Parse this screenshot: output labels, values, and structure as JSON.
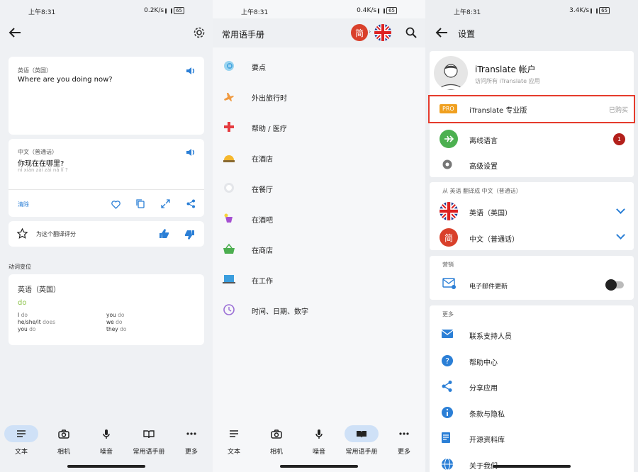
{
  "status": {
    "time": "上午8:31",
    "speeds": [
      "0.2K/s",
      "0.4K/s",
      "3.4K/s"
    ],
    "battery": "65"
  },
  "translate": {
    "source_lang": "英语（英国）",
    "source_text": "Where are you doing now?",
    "target_lang": "中文（普通话）",
    "target_text": "你现在在哪里?",
    "pinyin": "nǐ xiàn zài zài nǎ lǐ ?",
    "clear_label": "清除",
    "rate_label": "为这个翻译评分",
    "conjugation_title": "动词变位",
    "conj_lang": "英语（英国）",
    "verb": "do",
    "conj": [
      {
        "pronoun": "I",
        "form": "do"
      },
      {
        "pronoun": "you",
        "form": "do"
      },
      {
        "pronoun": "he/she/it",
        "form": "does"
      },
      {
        "pronoun": "we",
        "form": "do"
      },
      {
        "pronoun": "you",
        "form": "do"
      },
      {
        "pronoun": "they",
        "form": "do"
      }
    ]
  },
  "nav": {
    "text": "文本",
    "camera": "相机",
    "voice": "噪音",
    "phrasebook": "常用语手册",
    "more": "更多"
  },
  "phrasebook": {
    "title": "常用语手册",
    "flag_label": "简",
    "items": [
      "要点",
      "外出旅行时",
      "帮助 / 医疗",
      "在酒店",
      "在餐厅",
      "在酒吧",
      "在商店",
      "在工作",
      "时间、日期、数字"
    ]
  },
  "settings": {
    "title": "设置",
    "account_title": "iTranslate 帐户",
    "account_sub": "访问所有 iTranslate 应用",
    "pro_badge": "PRO",
    "pro_label": "iTranslate 专业版",
    "pro_status": "已购买",
    "offline_label": "离线语言",
    "offline_badge": "1",
    "advanced_label": "高级设置",
    "direction_label": "从 英语 翻译成 中文（普通话）",
    "lang_from": "英语（英国）",
    "lang_to": "中文（普通话）",
    "zh_flag": "简",
    "marketing_label": "营销",
    "email_label": "电子邮件更新",
    "more_label": "更多",
    "more_items": [
      "联系支持人员",
      "帮助中心",
      "分享应用",
      "条款与隐私",
      "开源资料库",
      "关于我们"
    ]
  },
  "colors": {
    "accent": "#2b7fd6",
    "pro_orange": "#f0a020",
    "highlight_red": "#e53b2c",
    "zh_red": "#d9402b"
  }
}
